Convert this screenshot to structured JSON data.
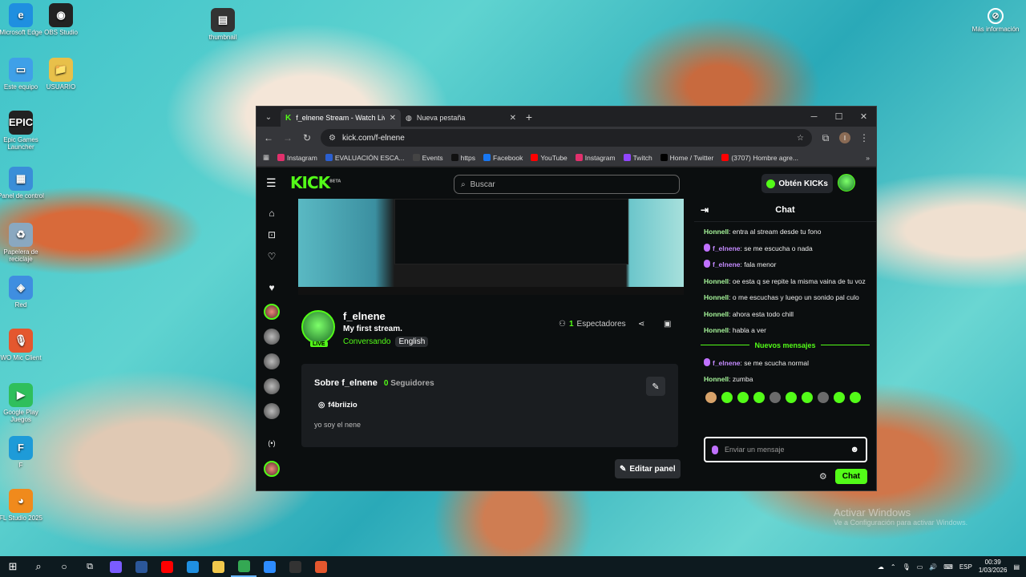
{
  "desktop": {
    "icons_left": [
      {
        "label": "Microsoft Edge",
        "glyph": "e",
        "color": "#1f8fe0"
      },
      {
        "label": "Este equipo",
        "glyph": "▭",
        "color": "#3fa0e8"
      },
      {
        "label": "Epic Games Launcher",
        "glyph": "EPIC",
        "color": "#222222"
      },
      {
        "label": "Panel de control",
        "glyph": "▦",
        "color": "#3a8ed8"
      },
      {
        "label": "Papelera de reciclaje",
        "glyph": "♻",
        "color": "#8aa8c0"
      },
      {
        "label": "Red",
        "glyph": "◈",
        "color": "#3f8ee0"
      },
      {
        "label": "WO Mic Client",
        "glyph": "🎙",
        "color": "#e4572e"
      },
      {
        "label": "Google Play Juegos",
        "glyph": "▶",
        "color": "#2fbf5b"
      },
      {
        "label": "F",
        "glyph": "F",
        "color": "#1e9bd8"
      },
      {
        "label": "FL Studio 2025",
        "glyph": "◕",
        "color": "#f08a1c"
      }
    ],
    "icons_top": [
      {
        "label": "OBS Studio",
        "glyph": "◉",
        "color": "#222222"
      },
      {
        "label": "USUARIO",
        "glyph": "📁",
        "color": "#e8c04a"
      },
      {
        "label": "thumbnail",
        "glyph": "▤",
        "color": "#333333"
      }
    ],
    "icon_right": {
      "label": "Más información",
      "glyph": "⊘"
    },
    "watermark_title": "Activar Windows",
    "watermark_sub": "Ve a Configuración para activar Windows."
  },
  "browser": {
    "tabs": [
      {
        "title": "f_elnene Stream - Watch Live o",
        "active": true
      },
      {
        "title": "Nueva pestaña",
        "active": false
      }
    ],
    "url": "kick.com/f-elnene",
    "profile_initial": "I",
    "bookmarks": [
      {
        "label": "Instagram",
        "color": "#e1306c"
      },
      {
        "label": "EVALUACIÓN ESCA...",
        "color": "#2b5fd0"
      },
      {
        "label": "Events",
        "color": "#444444"
      },
      {
        "label": "https",
        "color": "#111111"
      },
      {
        "label": "Facebook",
        "color": "#1877f2"
      },
      {
        "label": "YouTube",
        "color": "#ff0000"
      },
      {
        "label": "Instagram",
        "color": "#e1306c"
      },
      {
        "label": "Twitch",
        "color": "#9146ff"
      },
      {
        "label": "Home / Twitter",
        "color": "#000000"
      },
      {
        "label": "(3707) Hombre agre...",
        "color": "#ff0000"
      }
    ]
  },
  "kick": {
    "search_placeholder": "Buscar",
    "get_kicks": "Obtén KICKs",
    "channel": {
      "name": "f_elnene",
      "title": "My first stream.",
      "category": "Conversando",
      "language": "English",
      "live": "LIVE",
      "viewers_count": "1",
      "viewers_label": "Espectadores"
    },
    "about": {
      "title": "Sobre f_elnene",
      "followers_count": "0",
      "followers_label": "Seguidores",
      "social": "f4briizio",
      "bio": "yo soy el nene"
    },
    "edit_panel": "Editar panel",
    "chat": {
      "title": "Chat",
      "messages_before": [
        {
          "user": "Honnell",
          "text": "entra al stream desde tu fono",
          "style": "green",
          "mic": false
        },
        {
          "user": "f_elnene",
          "text": "se me escucha o nada",
          "style": "purple",
          "mic": true
        },
        {
          "user": "f_elnene",
          "text": "fala menor",
          "style": "purple",
          "mic": true
        },
        {
          "user": "Honnell",
          "text": "oe esta q se repite la misma vaina de tu voz",
          "style": "green",
          "mic": false
        },
        {
          "user": "Honnell",
          "text": "o me escuchas y luego un sonido pal culo",
          "style": "green",
          "mic": false
        },
        {
          "user": "Honnell",
          "text": "ahora esta todo chill",
          "style": "green",
          "mic": false
        },
        {
          "user": "Honnell",
          "text": "habla a ver",
          "style": "green",
          "mic": false
        }
      ],
      "new_messages": "Nuevos mensajes",
      "messages_after": [
        {
          "user": "f_elnene",
          "text": "se me scucha normal",
          "style": "purple",
          "mic": true
        },
        {
          "user": "Honnell",
          "text": "zumba",
          "style": "green",
          "mic": false
        }
      ],
      "input_placeholder": "Enviar un mensaje",
      "send_label": "Chat"
    }
  },
  "taskbar": {
    "apps": [
      {
        "name": "copilot",
        "color": "#7a5cff"
      },
      {
        "name": "word",
        "color": "#2b579a"
      },
      {
        "name": "youtube",
        "color": "#ff0000"
      },
      {
        "name": "edge",
        "color": "#1f8fe0"
      },
      {
        "name": "explorer",
        "color": "#f2c94c"
      },
      {
        "name": "chrome",
        "color": "#34a853"
      },
      {
        "name": "zoom",
        "color": "#2d8cff"
      },
      {
        "name": "obs",
        "color": "#333333"
      },
      {
        "name": "womic",
        "color": "#e4572e"
      }
    ],
    "lang": "ESP",
    "time": "00:39",
    "date": "1/03/2026"
  }
}
